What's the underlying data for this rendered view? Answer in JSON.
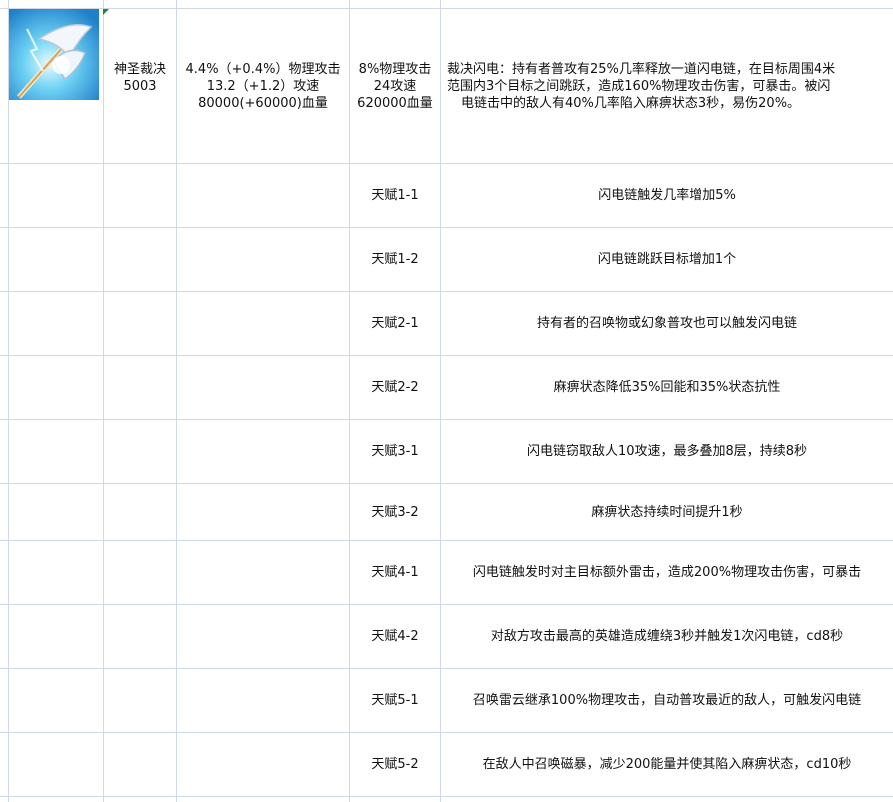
{
  "header_row": {
    "name": [
      "神圣裁决",
      "5003"
    ],
    "stats_growth": [
      "4.4%（+0.4%）物理攻击",
      "13.2（+1.2）攻速",
      "80000(+60000)血量"
    ],
    "stats_base": [
      "8%物理攻击",
      "24攻速",
      "620000血量"
    ],
    "skill": [
      "裁决闪电：持有者普攻有25%几率释放一道闪电链，在目标周围4米",
      "范围内3个目标之间跳跃，造成160%物理攻击伤害，可暴击。被闪",
      "电链击中的敌人有40%几率陷入麻痹状态3秒，易伤20%。"
    ]
  },
  "talents": [
    {
      "label": "天赋1-1",
      "text": "闪电链触发几率增加5%"
    },
    {
      "label": "天赋1-2",
      "text": "闪电链跳跃目标增加1个"
    },
    {
      "label": "天赋2-1",
      "text": "持有者的召唤物或幻象普攻也可以触发闪电链"
    },
    {
      "label": "天赋2-2",
      "text": "麻痹状态降低35%回能和35%状态抗性"
    },
    {
      "label": "天赋3-1",
      "text": "闪电链窃取敌人10攻速，最多叠加8层，持续8秒"
    },
    {
      "label": "天赋3-2",
      "text": "麻痹状态持续时间提升1秒"
    },
    {
      "label": "天赋4-1",
      "text": "闪电链触发时对主目标额外雷击，造成200%物理攻击伤害，可暴击"
    },
    {
      "label": "天赋4-2",
      "text": "对敌方攻击最高的英雄造成缠绕3秒并触发1次闪电链，cd8秒"
    },
    {
      "label": "天赋5-1",
      "text": "召唤雷云继承100%物理攻击，自动普攻最近的敌人，可触发闪电链"
    },
    {
      "label": "天赋5-2",
      "text": "在敌人中召唤磁暴，减少200能量并使其陷入麻痹状态，cd10秒"
    }
  ]
}
